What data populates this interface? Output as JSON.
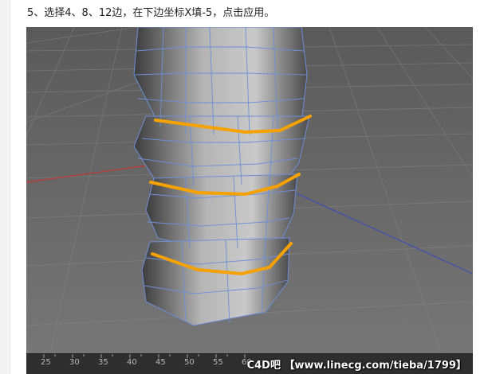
{
  "instruction": {
    "text": "5、选择4、8、12边，在下边坐标X填-5，点击应用。"
  },
  "viewport": {
    "highlight_color": "#f5a200",
    "mesh_color": "#6d8fd6"
  },
  "ruler": {
    "labels": [
      "25",
      "30",
      "35",
      "40",
      "45",
      "50",
      "55",
      "60"
    ]
  },
  "watermark": {
    "text": "C4D吧 【www.linecg.com/tieba/1799】"
  }
}
